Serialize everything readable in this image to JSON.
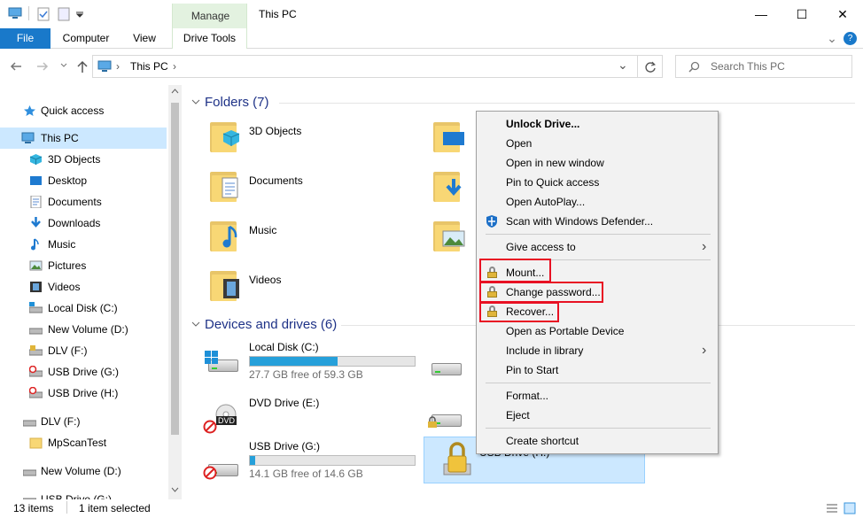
{
  "window": {
    "title": "This PC",
    "minimize": "—",
    "maximize": "☐",
    "close": "✕"
  },
  "ribbon": {
    "tabs": {
      "file": "File",
      "computer": "Computer",
      "view": "View",
      "drive_tools": "Drive Tools"
    },
    "context_label": "Manage",
    "expand_icon": "⌄",
    "help_icon": "?"
  },
  "address": {
    "location": "This PC",
    "sep": "›",
    "dropdown": "⌄",
    "search_placeholder": "Search This PC"
  },
  "nav": {
    "items": [
      {
        "label": "Quick access",
        "icon": "star-icon"
      },
      {
        "label": "This PC",
        "icon": "computer-icon"
      },
      {
        "label": "3D Objects",
        "icon": "cube-icon"
      },
      {
        "label": "Desktop",
        "icon": "desktop-icon"
      },
      {
        "label": "Documents",
        "icon": "documents-icon"
      },
      {
        "label": "Downloads",
        "icon": "download-icon"
      },
      {
        "label": "Music",
        "icon": "music-icon"
      },
      {
        "label": "Pictures",
        "icon": "pictures-icon"
      },
      {
        "label": "Videos",
        "icon": "videos-icon"
      },
      {
        "label": "Local Disk (C:)",
        "icon": "drive-icon"
      },
      {
        "label": "New Volume (D:)",
        "icon": "drive-icon"
      },
      {
        "label": "DLV (F:)",
        "icon": "usb-drive-icon"
      },
      {
        "label": "USB Drive (G:)",
        "icon": "usb-drive-icon"
      },
      {
        "label": "USB Drive (H:)",
        "icon": "usb-drive-icon"
      },
      {
        "label": "DLV (F:)",
        "icon": "usb-drive-icon"
      },
      {
        "label": "MpScanTest",
        "icon": "folder-icon"
      },
      {
        "label": "New Volume (D:)",
        "icon": "drive-icon"
      },
      {
        "label": "USB Drive (G:)",
        "icon": "usb-drive-icon"
      }
    ]
  },
  "content": {
    "folders_header": "Folders (7)",
    "folders": [
      "3D Objects",
      "Documents",
      "Music",
      "Videos"
    ],
    "devices_header": "Devices and drives (6)",
    "drives": [
      {
        "name": "Local Disk (C:)",
        "free": "27.7 GB free of 59.3 GB",
        "used_fraction": 0.53
      },
      {
        "name": "DVD Drive (E:)",
        "badge": "DVD"
      },
      {
        "name": "USB Drive (G:)",
        "free": "14.1 GB free of 14.6 GB",
        "used_fraction": 0.03
      }
    ],
    "selected_drive_partial": "USB Drive (H:)"
  },
  "context_menu": {
    "items": [
      {
        "label": "Unlock Drive...",
        "bold": true
      },
      {
        "label": "Open"
      },
      {
        "label": "Open in new window"
      },
      {
        "label": "Pin to Quick access"
      },
      {
        "label": "Open AutoPlay..."
      },
      {
        "label": "Scan with Windows Defender..."
      },
      {
        "label": "Give access to",
        "submenu": true
      },
      {
        "label": "Mount..."
      },
      {
        "label": "Change password..."
      },
      {
        "label": "Recover..."
      },
      {
        "label": "Open as Portable Device"
      },
      {
        "label": "Include in library",
        "submenu": true
      },
      {
        "label": "Pin to Start"
      },
      {
        "label": "Format..."
      },
      {
        "label": "Eject"
      },
      {
        "label": "Create shortcut"
      }
    ],
    "submenu_arrow": "›"
  },
  "status": {
    "count": "13 items",
    "selected": "1 item selected"
  },
  "colors": {
    "accent": "#1979ca",
    "highlight": "#e81123",
    "selection": "#cce8ff"
  }
}
